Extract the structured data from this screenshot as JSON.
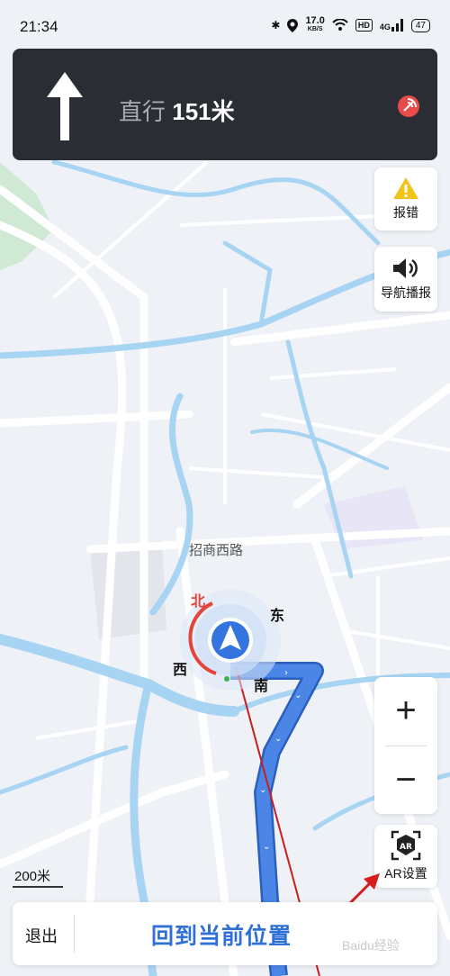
{
  "status_bar": {
    "time": "21:34",
    "net_speed": "17.0",
    "net_unit": "KB/S",
    "hd": "HD",
    "signal": "4G",
    "battery": "47"
  },
  "guidance": {
    "action": "直行",
    "distance": "151米",
    "arrow_icon": "straight-arrow-icon",
    "gps_icon": "gps-signal-icon"
  },
  "side_buttons": {
    "report_label": "报错",
    "voice_label": "导航播报",
    "ar_label": "AR设置",
    "ar_icon_text": "AR"
  },
  "zoom": {
    "in": "+",
    "out": "−"
  },
  "map": {
    "road_name": "招商西路",
    "compass": {
      "north": "北",
      "east": "东",
      "south": "南",
      "west": "西"
    },
    "scale": "200米",
    "route_color": "#3f78dc",
    "water_color": "#a8d4f3"
  },
  "bottom_bar": {
    "exit": "退出",
    "recenter": "回到当前位置",
    "watermark": "Baidu经验"
  }
}
